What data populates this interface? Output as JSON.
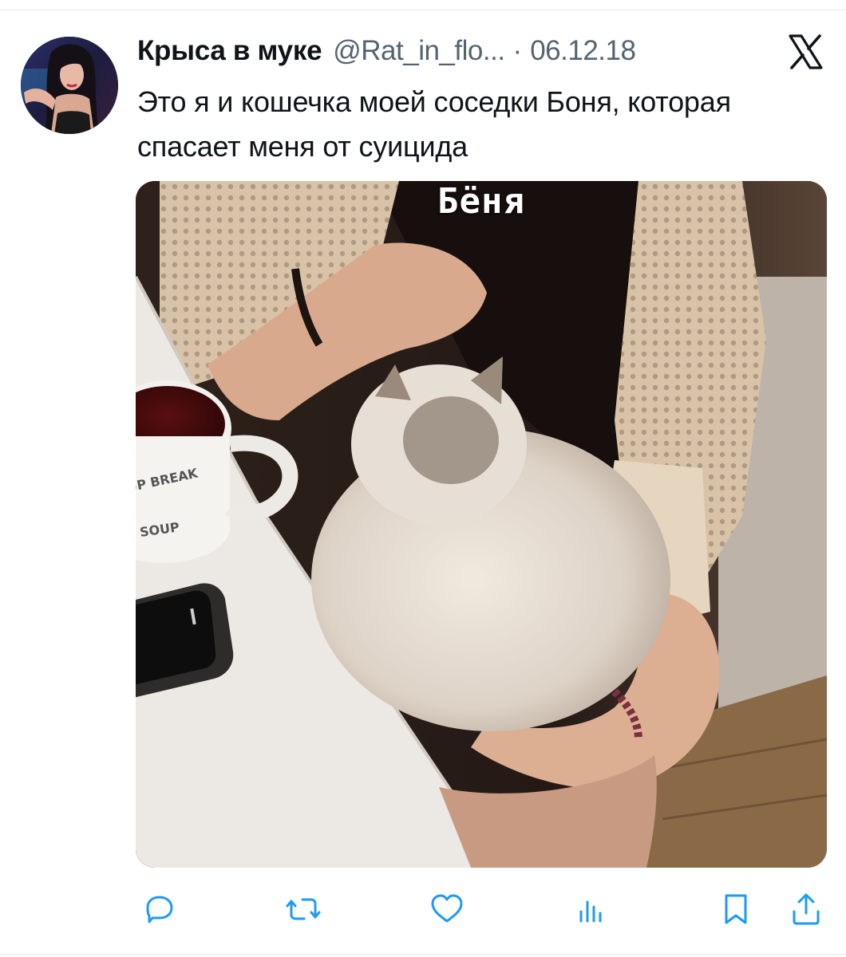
{
  "tweet": {
    "display_name": "Крыса в муке",
    "handle": "@Rat_in_flo...",
    "separator": "·",
    "date": "06.12.18",
    "text": "Это я и кошечка моей соседки Боня, которая спасает меня от суицида",
    "media_caption": "Бёня"
  },
  "icons": {
    "platform_logo": "x-logo-icon",
    "reply": "reply-icon",
    "retweet": "retweet-icon",
    "like": "heart-icon",
    "views": "views-icon",
    "bookmark": "bookmark-icon",
    "share": "share-icon"
  },
  "colors": {
    "text": "#0f1419",
    "secondary": "#536471",
    "action_icon": "#1d9bf0"
  }
}
